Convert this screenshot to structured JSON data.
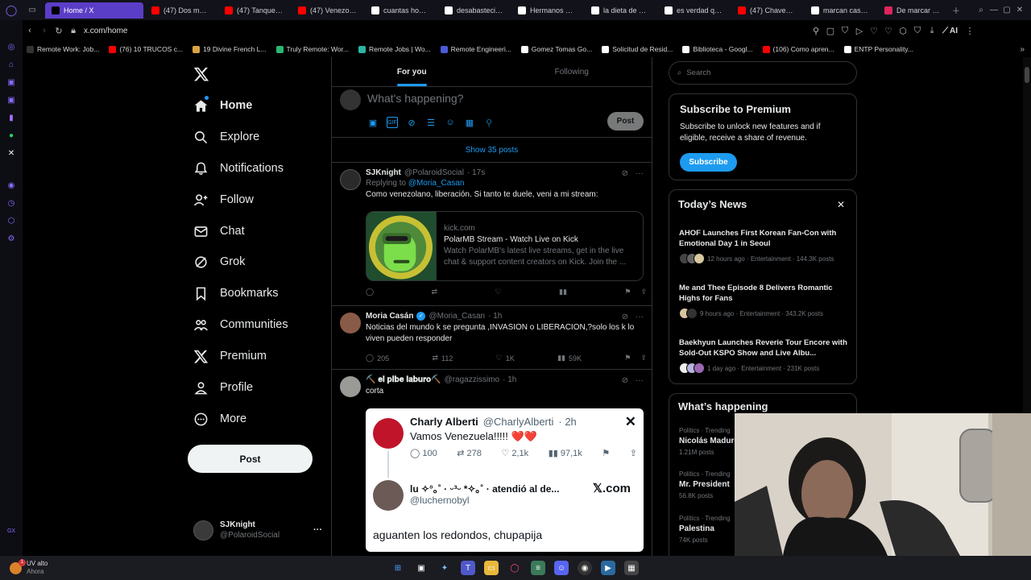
{
  "browser": {
    "tabs": [
      {
        "label": "Home / X",
        "icon": "x-icon",
        "color": "#000000"
      },
      {
        "label": "(47) Dos meses",
        "icon": "youtube-icon",
        "color": "#ff0000"
      },
      {
        "label": "(47) Tanque pa",
        "icon": "youtube-icon",
        "color": "#ff0000"
      },
      {
        "label": "(47) Venezolan",
        "icon": "youtube-icon",
        "color": "#ff0000"
      },
      {
        "label": "cuantas homicio",
        "icon": "google-icon",
        "color": "#ffffff"
      },
      {
        "label": "desabastecimie",
        "icon": "google-icon",
        "color": "#ffffff"
      },
      {
        "label": "Hermanos Fadd",
        "icon": "google-icon",
        "color": "#ffffff"
      },
      {
        "label": "la dieta de mad",
        "icon": "google-icon",
        "color": "#ffffff"
      },
      {
        "label": "es verdad que c",
        "icon": "google-icon",
        "color": "#ffffff"
      },
      {
        "label": "(47) Chavez ins",
        "icon": "youtube-icon",
        "color": "#ff0000"
      },
      {
        "label": "marcan casas d",
        "icon": "google-icon",
        "color": "#ffffff"
      },
      {
        "label": "De marcar casa",
        "icon": "page-icon",
        "color": "#e0245e"
      }
    ],
    "url": "x.com/home",
    "ai_label": "AI",
    "bookmarks": [
      {
        "label": "Remote Work: Job...",
        "icon": "r-icon",
        "color": "#333333"
      },
      {
        "label": "(76) 10 TRUCOS c...",
        "icon": "youtube-icon",
        "color": "#ff0000"
      },
      {
        "label": "19 Divine French L...",
        "icon": "bookmark-icon",
        "color": "#d9a441"
      },
      {
        "label": "Truly Remote: Wor...",
        "icon": "leaf-icon",
        "color": "#2bb673"
      },
      {
        "label": "Remote Jobs | Wo...",
        "icon": "globe-icon",
        "color": "#2bb6a0"
      },
      {
        "label": "Remote Engineeri...",
        "icon": "n-icon",
        "color": "#4a5bd4"
      },
      {
        "label": "Gomez Tomas Go...",
        "icon": "triangle-icon",
        "color": "#ffffff"
      },
      {
        "label": "Solicitud de Resid...",
        "icon": "circle-icon",
        "color": "#ffffff"
      },
      {
        "label": "Biblioteca - Googl...",
        "icon": "book-icon",
        "color": "#ffffff"
      },
      {
        "label": "(106) Como apren...",
        "icon": "youtube-icon",
        "color": "#ff0000"
      },
      {
        "label": "ENTP Personality...",
        "icon": "circle-icon",
        "color": "#ffffff"
      }
    ]
  },
  "nav": {
    "items": [
      {
        "label": "Home",
        "icon": "home-icon"
      },
      {
        "label": "Explore",
        "icon": "search-icon"
      },
      {
        "label": "Notifications",
        "icon": "bell-icon"
      },
      {
        "label": "Follow",
        "icon": "add-person-icon"
      },
      {
        "label": "Chat",
        "icon": "mail-icon"
      },
      {
        "label": "Grok",
        "icon": "grok-icon"
      },
      {
        "label": "Bookmarks",
        "icon": "bookmark-icon"
      },
      {
        "label": "Communities",
        "icon": "people-icon"
      },
      {
        "label": "Premium",
        "icon": "x-icon"
      },
      {
        "label": "Profile",
        "icon": "person-icon"
      },
      {
        "label": "More",
        "icon": "more-circle-icon"
      }
    ],
    "post_label": "Post",
    "account": {
      "name": "SJKnight",
      "handle": "@PolaroidSocial"
    }
  },
  "feed": {
    "tabs": [
      "For you",
      "Following"
    ],
    "compose_placeholder": "What's happening?",
    "compose_post": "Post",
    "show_more": "Show 35 posts",
    "tweets": [
      {
        "name": "SJKnight",
        "handle": "@PolaroidSocial",
        "time": "· 17s",
        "reply_prefix": "Replying to",
        "reply_to": "@Moria_Casan",
        "text": "Como venezolano, liberación. Si tanto te duele, veni a mi stream:",
        "card": {
          "domain": "kick.com",
          "title": "PolarMB Stream - Watch Live on Kick",
          "desc": "Watch PolarMB's latest live streams, get in the live chat & support content creators on Kick. Join the ..."
        }
      },
      {
        "name": "Moria Casán",
        "handle": "@Moria_Casan",
        "time": "· 1h",
        "text": "Noticias del mundo k se pregunta ,INVASION o LIBERACION,?solo los k lo viven pueden responder",
        "stats": {
          "replies": "205",
          "reposts": "112",
          "likes": "1K",
          "views": "59K"
        }
      },
      {
        "name": "⛏️ 𝐞𝐥 𝐩𝐢𝐛𝐞 𝐥𝐚𝐛𝐮𝐫𝐨⛏️",
        "handle": "@ragazzissimo",
        "time": "· 1h",
        "text": "corta",
        "quote": {
          "name": "Charly Alberti",
          "handle": "@CharlyAlberti",
          "time": "· 2h",
          "text": "Vamos Venezuela!!!!! ❤️❤️",
          "stats": {
            "replies": "100",
            "reposts": "278",
            "likes": "2,1k",
            "views": "97,1k"
          },
          "reply_name": "lu ✧°｡˚ · ᵕ³ᵕ *✧｡˚ · atendió al de...",
          "reply_handle": "@luchernobyl",
          "brand": "𝕏.com",
          "reply_text": "aguanten los redondos, chupapija"
        }
      }
    ]
  },
  "right": {
    "search_placeholder": "Search",
    "premium": {
      "title": "Subscribe to Premium",
      "text": "Subscribe to unlock new features and if eligible, receive a share of revenue.",
      "button": "Subscribe"
    },
    "news_title": "Today’s News",
    "news": [
      {
        "title": "AHOF Launches First Korean Fan-Con with Emotional Day 1 in Seoul",
        "meta": "12 hours ago · Entertainment · 144.3K posts"
      },
      {
        "title": "Me and Thee Episode 8 Delivers Romantic Highs for Fans",
        "meta": "9 hours ago · Entertainment · 343.2K posts"
      },
      {
        "title": "Baekhyun Launches Reverie Tour Encore with Sold-Out KSPO Show and Live Albu...",
        "meta": "1 day ago · Entertainment · 231K posts"
      }
    ],
    "happening_title": "What’s happening",
    "trends": [
      {
        "context": "Politics · Trending",
        "name": "Nicolás Maduro",
        "posts": "1.21M posts"
      },
      {
        "context": "Politics · Trending",
        "name": "Mr. President",
        "posts": "56.8K posts"
      },
      {
        "context": "Politics · Trending",
        "name": "Palestina",
        "posts": "74K posts"
      }
    ]
  },
  "taskbar": {
    "weather": {
      "title": "UV alto",
      "subtitle": "Ahora",
      "badge": "1"
    }
  }
}
